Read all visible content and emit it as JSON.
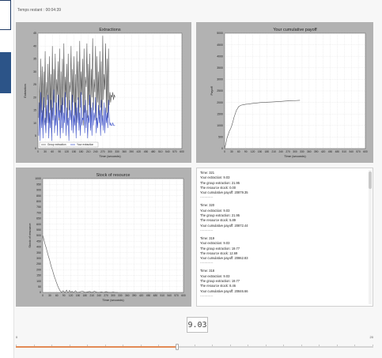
{
  "timer": {
    "label": "Temps restant : 00:04:39"
  },
  "colors": {
    "panel_bg": "#b2b2b2",
    "plot_bg": "#ffffff",
    "grid": "#cccccc",
    "group_line": "#555555",
    "your_line": "#3a4fc8",
    "slider_fill": "#e28a55",
    "sidebar_tab": "#2c5488"
  },
  "chart_data": [
    {
      "type": "line",
      "title": "Extractions",
      "xlabel": "Time (seconds)",
      "ylabel": "Extraction",
      "xlim": [
        0,
        600
      ],
      "ylim": [
        0,
        45
      ],
      "xticks": [
        0,
        30,
        60,
        90,
        120,
        150,
        180,
        210,
        240,
        270,
        300,
        330,
        360,
        390,
        420,
        450,
        480,
        510,
        540,
        570,
        600
      ],
      "yticks": [
        0,
        5,
        10,
        15,
        20,
        25,
        30,
        35,
        40,
        45
      ],
      "legend": "bottom-left",
      "series": [
        {
          "name": "Group extraction",
          "color": "#555555",
          "x": [
            3,
            6,
            9,
            12,
            15,
            18,
            21,
            24,
            27,
            30,
            33,
            36,
            39,
            42,
            45,
            48,
            51,
            54,
            57,
            60,
            63,
            66,
            69,
            72,
            75,
            78,
            81,
            84,
            87,
            90,
            93,
            96,
            99,
            102,
            105,
            108,
            111,
            114,
            117,
            120,
            123,
            126,
            129,
            132,
            135,
            138,
            141,
            144,
            147,
            150,
            153,
            156,
            159,
            162,
            165,
            168,
            171,
            174,
            177,
            180,
            183,
            186,
            189,
            192,
            195,
            198,
            201,
            204,
            207,
            210,
            213,
            216,
            219,
            222,
            225,
            228,
            231,
            234,
            237,
            240,
            243,
            246,
            249,
            252,
            255,
            258,
            261,
            264,
            267,
            270,
            273,
            276,
            279,
            282,
            285,
            288,
            291,
            294,
            297,
            300,
            303,
            306,
            309,
            312,
            315,
            318,
            321
          ],
          "y": [
            12,
            28,
            9,
            35,
            14,
            32,
            8,
            30,
            16,
            38,
            7,
            26,
            19,
            33,
            10,
            36,
            15,
            29,
            6,
            40,
            13,
            31,
            18,
            37,
            9,
            27,
            21,
            34,
            11,
            39,
            14,
            30,
            8,
            35,
            17,
            41,
            12,
            28,
            20,
            33,
            9,
            37,
            15,
            26,
            22,
            40,
            10,
            31,
            18,
            36,
            13,
            29,
            7,
            38,
            19,
            34,
            11,
            42,
            16,
            30,
            21,
            35,
            9,
            39,
            14,
            28,
            24,
            41,
            12,
            33,
            17,
            37,
            8,
            31,
            20,
            43,
            15,
            27,
            22,
            40,
            11,
            36,
            18,
            30,
            13,
            38,
            16,
            34,
            10,
            44,
            19,
            29,
            23,
            41,
            14,
            35,
            12,
            39,
            17,
            22,
            18,
            21,
            20,
            22,
            19,
            21,
            20
          ]
        },
        {
          "name": "Your extraction",
          "color": "#3a4fc8",
          "x": [
            3,
            6,
            9,
            12,
            15,
            18,
            21,
            24,
            27,
            30,
            33,
            36,
            39,
            42,
            45,
            48,
            51,
            54,
            57,
            60,
            63,
            66,
            69,
            72,
            75,
            78,
            81,
            84,
            87,
            90,
            93,
            96,
            99,
            102,
            105,
            108,
            111,
            114,
            117,
            120,
            123,
            126,
            129,
            132,
            135,
            138,
            141,
            144,
            147,
            150,
            153,
            156,
            159,
            162,
            165,
            168,
            171,
            174,
            177,
            180,
            183,
            186,
            189,
            192,
            195,
            198,
            201,
            204,
            207,
            210,
            213,
            216,
            219,
            222,
            225,
            228,
            231,
            234,
            237,
            240,
            243,
            246,
            249,
            252,
            255,
            258,
            261,
            264,
            267,
            270,
            273,
            276,
            279,
            282,
            285,
            288,
            291,
            294,
            297,
            300,
            303,
            306,
            309,
            312,
            315,
            318,
            321
          ],
          "y": [
            5,
            18,
            3,
            22,
            8,
            15,
            4,
            20,
            9,
            12,
            6,
            17,
            10,
            21,
            4,
            14,
            8,
            19,
            3,
            16,
            11,
            23,
            6,
            13,
            9,
            18,
            5,
            21,
            12,
            15,
            4,
            17,
            8,
            20,
            6,
            14,
            10,
            22,
            5,
            16,
            9,
            12,
            3,
            19,
            11,
            15,
            7,
            21,
            6,
            13,
            9,
            18,
            4,
            16,
            10,
            20,
            7,
            14,
            5,
            22,
            9,
            12,
            11,
            17,
            6,
            19,
            8,
            15,
            4,
            13,
            10,
            21,
            7,
            16,
            5,
            18,
            9,
            14,
            11,
            20,
            6,
            12,
            8,
            17,
            10,
            15,
            5,
            19,
            9,
            13,
            7,
            18,
            6,
            16,
            10,
            14,
            8,
            19,
            12,
            9,
            10,
            9,
            9,
            10,
            9,
            9,
            9
          ]
        }
      ]
    },
    {
      "type": "line",
      "title": "Your cumulative payoff",
      "xlabel": "Time (seconds)",
      "ylabel": "Payoff",
      "xlim": [
        0,
        600
      ],
      "ylim": [
        0,
        5000
      ],
      "xticks": [
        0,
        30,
        60,
        90,
        120,
        150,
        180,
        210,
        240,
        270,
        300,
        330,
        360,
        390,
        420,
        450,
        480,
        510,
        540,
        570,
        600
      ],
      "yticks": [
        0,
        500,
        1000,
        1500,
        2000,
        2500,
        3000,
        3500,
        4000,
        4500,
        5000
      ],
      "series": [
        {
          "name": "",
          "color": "#555555",
          "x": [
            0,
            5,
            10,
            15,
            20,
            25,
            30,
            35,
            40,
            45,
            50,
            60,
            70,
            80,
            90,
            100,
            120,
            140,
            160,
            180,
            200,
            220,
            240,
            260,
            280,
            300,
            321
          ],
          "y": [
            0,
            200,
            450,
            600,
            750,
            850,
            980,
            1150,
            1350,
            1500,
            1650,
            1820,
            1880,
            1900,
            1920,
            1930,
            1960,
            1980,
            2000,
            2010,
            2020,
            2030,
            2045,
            2060,
            2070,
            2080,
            2090
          ]
        }
      ]
    },
    {
      "type": "line",
      "title": "Stock of resource",
      "xlabel": "Time (seconds)",
      "ylabel": "Stock of resource",
      "xlim": [
        0,
        600
      ],
      "ylim": [
        0,
        1000
      ],
      "xticks": [
        0,
        30,
        60,
        90,
        120,
        150,
        180,
        210,
        240,
        270,
        300,
        330,
        360,
        390,
        420,
        450,
        480,
        510,
        540,
        570,
        600
      ],
      "yticks": [
        0,
        50,
        100,
        150,
        200,
        250,
        300,
        350,
        400,
        450,
        500,
        550,
        600,
        650,
        700,
        750,
        800,
        850,
        900,
        950,
        1000
      ],
      "series": [
        {
          "name": "",
          "color": "#555555",
          "x": [
            0,
            3,
            6,
            9,
            12,
            15,
            18,
            21,
            24,
            27,
            30,
            33,
            36,
            39,
            42,
            45,
            48,
            51,
            54,
            57,
            60,
            63,
            66,
            69,
            72,
            75,
            78,
            81,
            84,
            87,
            90,
            93,
            96,
            99,
            102,
            105,
            108,
            111,
            114,
            117,
            120,
            125,
            130,
            135,
            140,
            145,
            150,
            160,
            170,
            180,
            190,
            200,
            210,
            220,
            230,
            240,
            250,
            260,
            270,
            280,
            290,
            300,
            310,
            321
          ],
          "y": [
            500,
            480,
            455,
            430,
            410,
            390,
            365,
            345,
            320,
            300,
            280,
            255,
            230,
            210,
            195,
            170,
            150,
            130,
            115,
            95,
            80,
            62,
            48,
            35,
            22,
            12,
            5,
            2,
            8,
            15,
            6,
            2,
            0,
            12,
            20,
            5,
            0,
            3,
            18,
            8,
            2,
            10,
            0,
            4,
            15,
            2,
            0,
            6,
            12,
            0,
            4,
            8,
            0,
            10,
            2,
            0,
            5,
            0,
            7,
            1,
            0,
            3,
            0,
            0
          ]
        }
      ]
    }
  ],
  "log": {
    "entries": [
      {
        "time": "Time: 321",
        "your_extraction": "Your extraction: 9.03",
        "group_extraction": "The group extraction: 21.95",
        "stock": "The resource stock: 0.00",
        "payoff": "Your cumulative payoff: 20879.35"
      },
      {
        "time": "Time: 320",
        "your_extraction": "Your extraction: 9.03",
        "group_extraction": "The group extraction: 21.95",
        "stock": "The resource stock: 5.89",
        "payoff": "Your cumulative payoff: 20872.44"
      },
      {
        "time": "Time: 319",
        "your_extraction": "Your extraction: 9.03",
        "group_extraction": "The group extraction: 19.77",
        "stock": "The resource stock: 12.69",
        "payoff": "Your cumulative payoff: 20862.83"
      },
      {
        "time": "Time: 318",
        "your_extraction": "Your extraction: 9.03",
        "group_extraction": "The group extraction: 19.77",
        "stock": "The resource stock: 8.46",
        "payoff": "Your cumulative payoff: 20846.66"
      }
    ],
    "separator": "------------"
  },
  "slider": {
    "value_display": "9.03",
    "min_label": "0",
    "max_label": "20",
    "value": 9.03,
    "min": 0,
    "max": 20
  }
}
